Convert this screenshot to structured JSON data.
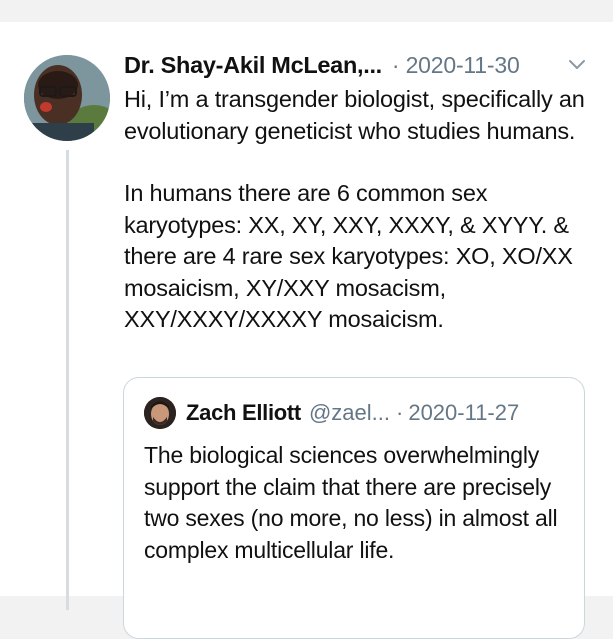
{
  "tweet": {
    "author_name": "Dr. Shay-Akil McLean,...",
    "separator": "·",
    "date": "2020-11-30",
    "paragraphs": [
      "Hi, I’m a transgender biologist, specifically an evolutionary geneticist who studies humans.",
      "In humans there are 6 common sex karyotypes: XX, XY, XXY, XXXY, & XYYY. & there are 4 rare sex karyotypes: XO, XO/XX mosaicism, XY/XXY mosacism, XXY/XXXY/XXXXY mosaicism."
    ]
  },
  "quoted_tweet": {
    "author_name": "Zach Elliott",
    "handle": "@zael...",
    "separator": "·",
    "date": "2020-11-27",
    "text": "The biological sciences overwhelmingly support the claim that there are precisely two sexes (no more, no less) in almost all complex multicellular life."
  },
  "icons": {
    "menu": "chevron-down-icon"
  },
  "colors": {
    "text": "#111111",
    "muted": "#657786",
    "border": "#ccd6dd",
    "thread_line": "#d6dde2"
  }
}
